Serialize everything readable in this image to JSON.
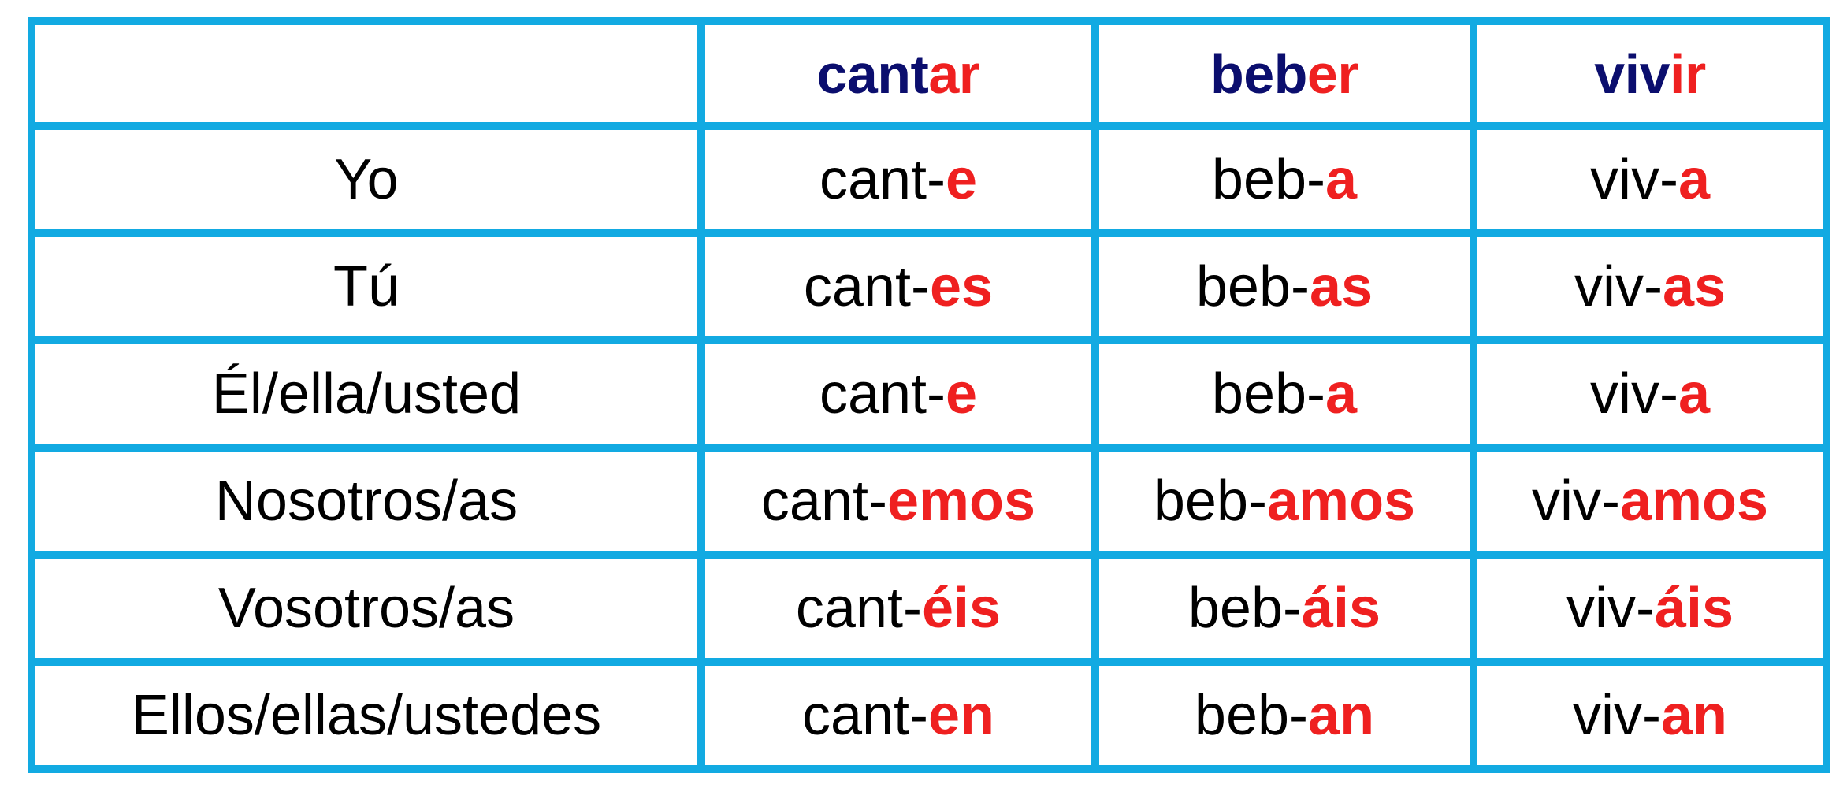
{
  "colors": {
    "border": "#12aae2",
    "stem_header": "#0b0e6e",
    "ending": "#ef2020",
    "text": "#000000"
  },
  "header": {
    "verbs": [
      {
        "stem": "cant",
        "ending": "ar"
      },
      {
        "stem": "beb",
        "ending": "er"
      },
      {
        "stem": "viv",
        "ending": "ir"
      }
    ]
  },
  "rows": [
    {
      "pronoun": "Yo",
      "forms": [
        {
          "stem": "cant-",
          "ending": "e"
        },
        {
          "stem": "beb-",
          "ending": "a"
        },
        {
          "stem": "viv-",
          "ending": "a"
        }
      ]
    },
    {
      "pronoun": "Tú",
      "forms": [
        {
          "stem": "cant-",
          "ending": "es"
        },
        {
          "stem": "beb-",
          "ending": "as"
        },
        {
          "stem": "viv-",
          "ending": "as"
        }
      ]
    },
    {
      "pronoun": "Él/ella/usted",
      "forms": [
        {
          "stem": "cant-",
          "ending": "e"
        },
        {
          "stem": "beb-",
          "ending": "a"
        },
        {
          "stem": "viv-",
          "ending": "a"
        }
      ]
    },
    {
      "pronoun": "Nosotros/as",
      "forms": [
        {
          "stem": "cant-",
          "ending": "emos"
        },
        {
          "stem": "beb-",
          "ending": "amos"
        },
        {
          "stem": "viv-",
          "ending": "amos"
        }
      ]
    },
    {
      "pronoun": "Vosotros/as",
      "forms": [
        {
          "stem": "cant-",
          "ending": "éis"
        },
        {
          "stem": "beb-",
          "ending": "áis"
        },
        {
          "stem": "viv-",
          "ending": "áis"
        }
      ]
    },
    {
      "pronoun": "Ellos/ellas/ustedes",
      "forms": [
        {
          "stem": "cant-",
          "ending": "en"
        },
        {
          "stem": "beb-",
          "ending": "an"
        },
        {
          "stem": "viv-",
          "ending": "an"
        }
      ]
    }
  ]
}
